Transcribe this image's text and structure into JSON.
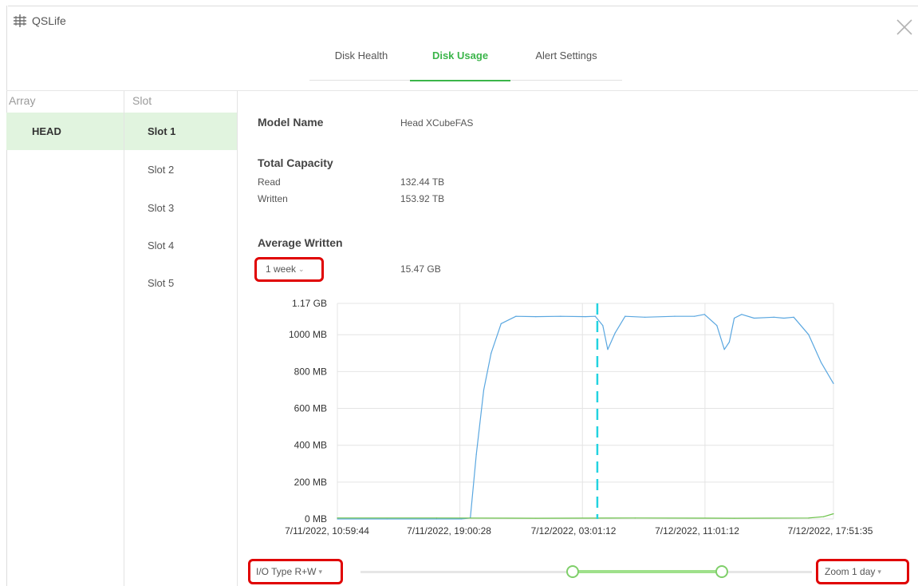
{
  "app": {
    "title": "QSLife"
  },
  "tabs": [
    {
      "label": "Disk Health"
    },
    {
      "label": "Disk Usage"
    },
    {
      "label": "Alert Settings"
    }
  ],
  "columns": {
    "array_header": "Array",
    "slot_header": "Slot"
  },
  "arrays": [
    {
      "label": "HEAD"
    }
  ],
  "slots": [
    {
      "label": "Slot 1"
    },
    {
      "label": "Slot 2"
    },
    {
      "label": "Slot 3"
    },
    {
      "label": "Slot 4"
    },
    {
      "label": "Slot 5"
    }
  ],
  "details": {
    "model_name_label": "Model Name",
    "model_name_value": "Head XCubeFAS",
    "total_capacity_label": "Total Capacity",
    "read_label": "Read",
    "read_value": "132.44 TB",
    "written_label": "Written",
    "written_value": "153.92 TB",
    "average_written_label": "Average Written",
    "period_selected": "1 week",
    "average_written_value": "15.47 GB"
  },
  "controls": {
    "io_type_selected": "I/O Type R+W",
    "zoom_selected": "Zoom 1 day",
    "range_selected": [
      0.47,
      0.8
    ]
  },
  "colors": {
    "accent": "#3bb54a",
    "selected_bg": "#e1f4df",
    "highlight_box": "#e00000",
    "series_blue": "#5aa7e0",
    "series_green": "#6cc24a",
    "cursor_line": "#22d3e0"
  },
  "chart_data": {
    "type": "line",
    "y_tick_labels": [
      "1.17 GB",
      "1000 MB",
      "800 MB",
      "600 MB",
      "400 MB",
      "200 MB",
      "0 MB"
    ],
    "y_tick_values": [
      1170,
      1000,
      800,
      600,
      400,
      200,
      0
    ],
    "ylim": [
      0,
      1170
    ],
    "x_tick_labels": [
      "7/11/2022, 10:59:44",
      "7/11/2022, 19:00:28",
      "7/12/2022, 03:01:12",
      "7/12/2022, 11:01:12",
      "7/12/2022, 17:51:35"
    ],
    "xlim": [
      0,
      1
    ],
    "cursor_x": 0.524,
    "grid": true,
    "series": [
      {
        "x": [
          0,
          0.1,
          0.2,
          0.25,
          0.268,
          0.28,
          0.295,
          0.31,
          0.33,
          0.36,
          0.4,
          0.45,
          0.5,
          0.52,
          0.535,
          0.545,
          0.56,
          0.58,
          0.62,
          0.68,
          0.72,
          0.74,
          0.765,
          0.78,
          0.79,
          0.8,
          0.815,
          0.84,
          0.88,
          0.9,
          0.92,
          0.95,
          0.975,
          1.0
        ],
        "y": [
          0,
          0,
          0,
          0,
          5,
          350,
          700,
          900,
          1060,
          1100,
          1098,
          1100,
          1098,
          1100,
          1050,
          920,
          1010,
          1100,
          1095,
          1100,
          1100,
          1110,
          1050,
          920,
          960,
          1090,
          1110,
          1090,
          1095,
          1090,
          1095,
          1000,
          850,
          735
        ]
      },
      {
        "x": [
          0,
          0.2,
          0.4,
          0.6,
          0.8,
          0.95,
          0.98,
          1.0
        ],
        "y": [
          5,
          5,
          4,
          5,
          4,
          5,
          12,
          28
        ]
      }
    ]
  }
}
